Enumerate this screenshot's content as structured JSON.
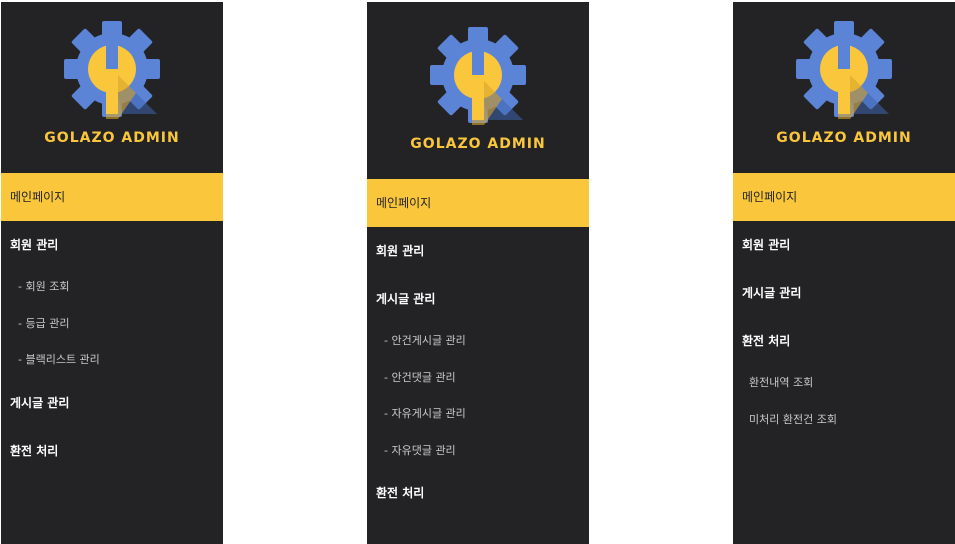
{
  "brand": "GOLAZO ADMIN",
  "colors": {
    "sidebar_bg": "#232325",
    "accent": "#f9c63c",
    "gear": "#5b84d6"
  },
  "panels": [
    {
      "main_page": "메인페이지",
      "member": "회원 관리",
      "member_sub": [
        "- 회원 조회",
        "- 등급 관리",
        "- 블랙리스트 관리"
      ],
      "posts": "게시글 관리",
      "exchange": "환전 처리"
    },
    {
      "main_page": "메인페이지",
      "member": "회원 관리",
      "posts": "게시글 관리",
      "posts_sub": [
        "- 안건게시글 관리",
        "- 안건댓글 관리",
        "- 자유게시글 관리",
        "- 자유댓글 관리"
      ],
      "exchange": "환전 처리"
    },
    {
      "main_page": "메인페이지",
      "member": "회원 관리",
      "posts": "게시글 관리",
      "exchange": "환전 처리",
      "exchange_sub": [
        "환전내역 조회",
        "미처리 환전건 조회"
      ]
    }
  ]
}
